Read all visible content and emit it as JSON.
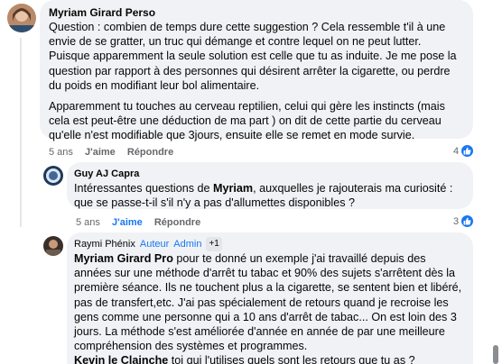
{
  "comments": [
    {
      "author": "Myriam Girard Perso",
      "paragraphs": [
        "Question : combien de temps dure cette suggestion ? Cela ressemble t'il à une envie de se gratter, un truc qui démange et contre lequel on ne peut lutter. Puisque apparemment la seule solution est celle que tu as induite. Je me pose la question par rapport à des personnes qui désirent arrêter la cigarette, ou perdre du poids en modifiant leur bol alimentaire.",
        "Apparemment tu touches au cerveau reptilien, celui qui gère les instincts (mais cela est peut-être une déduction de ma part ) on dit de cette partie du cerveau qu'elle n'est modifiable que 3jours, ensuite elle se remet en mode survie."
      ],
      "time": "5 ans",
      "like_label": "J'aime",
      "reply_label": "Répondre",
      "reaction_count": "4"
    },
    {
      "author": "Guy AJ Capra",
      "text_before": "Intéressantes questions de ",
      "mention": "Myriam",
      "text_after": ", auxquelles je rajouterais ma curiosité : que se passe-t-il s'il n'y a pas d'allumettes disponibles ?",
      "time": "5 ans",
      "like_label": "J'aime",
      "reply_label": "Répondre",
      "reaction_count": "3"
    },
    {
      "author": "Raymi Phénix",
      "badge_author": "Auteur",
      "badge_admin": "Admin",
      "badge_more": "+1",
      "mention1": "Myriam Girard Pro",
      "text1": " pour te donné un exemple j'ai travaillé depuis des années sur une méthode d'arrêt tu tabac et 90% des sujets s'arrêtent dès la première séance. Ils ne touchent plus a la cigarette, se sentent bien et libéré, pas de transfert,etc. J'ai pas spécialement de retours quand je recroise les gens comme une personne qui a 10 ans d'arrêt de tabac... On est loin des 3 jours. La méthode s'est améliorée d'année en année de par une meilleure compréhension des systèmes et programmes.",
      "mention2": "Kevin le Clainche",
      "text2": " toi qui l'utilises quels sont les retours que tu as ?"
    }
  ],
  "colors": {
    "bubble": "#f0f2f5",
    "accent": "#1877f2",
    "muted": "#65676b"
  },
  "icons": [
    "like-reaction-icon",
    "avatar-myriam",
    "avatar-guy",
    "avatar-raymi"
  ]
}
